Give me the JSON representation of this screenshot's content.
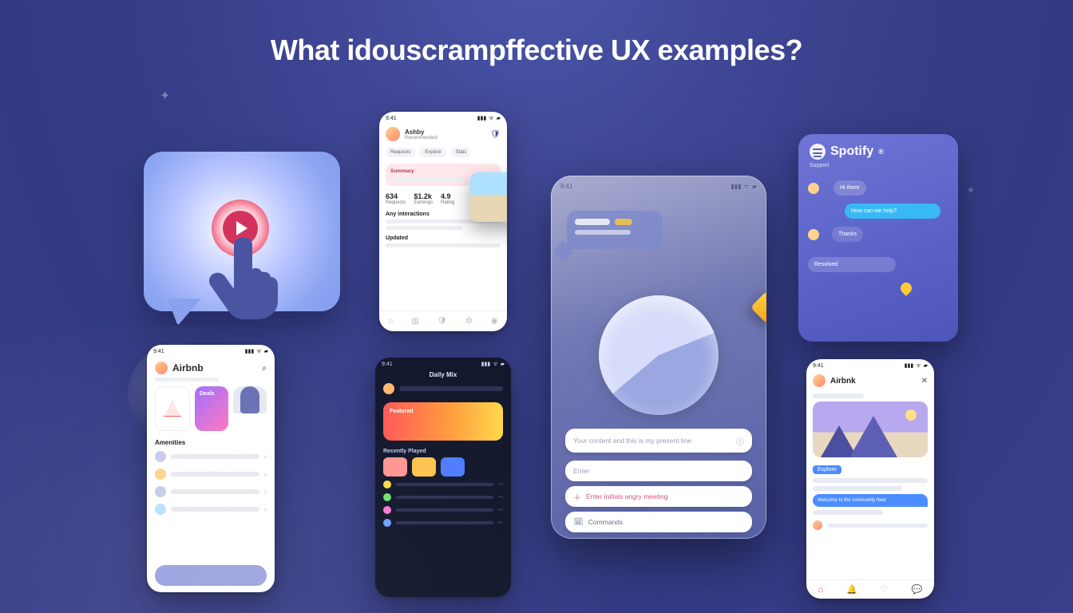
{
  "headline": "What idouscrampffective UX examples?",
  "statusbar": {
    "time": "9:41",
    "wifi_icon": "wifi",
    "signal_icon": "signal",
    "battery_icon": "battery"
  },
  "playcard": {
    "icon": "play-icon"
  },
  "phoneA": {
    "profile_name": "Ashby",
    "profile_subtitle": "Recommended",
    "shield_icon": "shield-icon",
    "pills": [
      "Requests",
      "Explore",
      "Stats"
    ],
    "banner_title": "Summary",
    "stats": [
      {
        "label": "Requests",
        "value": "634"
      },
      {
        "label": "Earnings",
        "value": "$1.2k"
      },
      {
        "label": "Rating",
        "value": "4.9"
      }
    ],
    "section1": "Any interactions",
    "section2": "Updated",
    "nav_icons": [
      "home",
      "stats",
      "shield",
      "settings",
      "profile"
    ]
  },
  "bigphone": {
    "input_placeholder": "Your content and this is my present line",
    "input_info_icon": "info-icon",
    "secondary_placeholder": "Enter",
    "tertiary_placeholder": "Enter initials angry meeting",
    "tertiary_plus_icon": "plus-icon",
    "quaternary_placeholder": "Commands",
    "quaternary_icon": "calendar-icon"
  },
  "spotify": {
    "brand": "Spotify",
    "reg_mark": "®",
    "subhead": "Support",
    "msg_in": "Hi there",
    "msg_team": "How can we help?",
    "msg_out": "Thanks",
    "badge": "Resolved",
    "pin_icon": "pin-icon"
  },
  "airbnb": {
    "brand": "Airbnb",
    "card_promo_label": "Deals",
    "section": "Amenities",
    "warn_icon": "warning-icon",
    "person_icon": "person-icon"
  },
  "music": {
    "title": "Daily Mix",
    "hero_label": "Featured",
    "section": "Recently Played"
  },
  "social": {
    "brand": "Airbnk",
    "close_icon": "close-icon",
    "tag": "Explore",
    "bubble": "Welcome to the community feed",
    "nav": {
      "home": "home-icon",
      "bell": "bell-icon",
      "heart": "heart-icon",
      "chat": "chat-icon"
    }
  }
}
